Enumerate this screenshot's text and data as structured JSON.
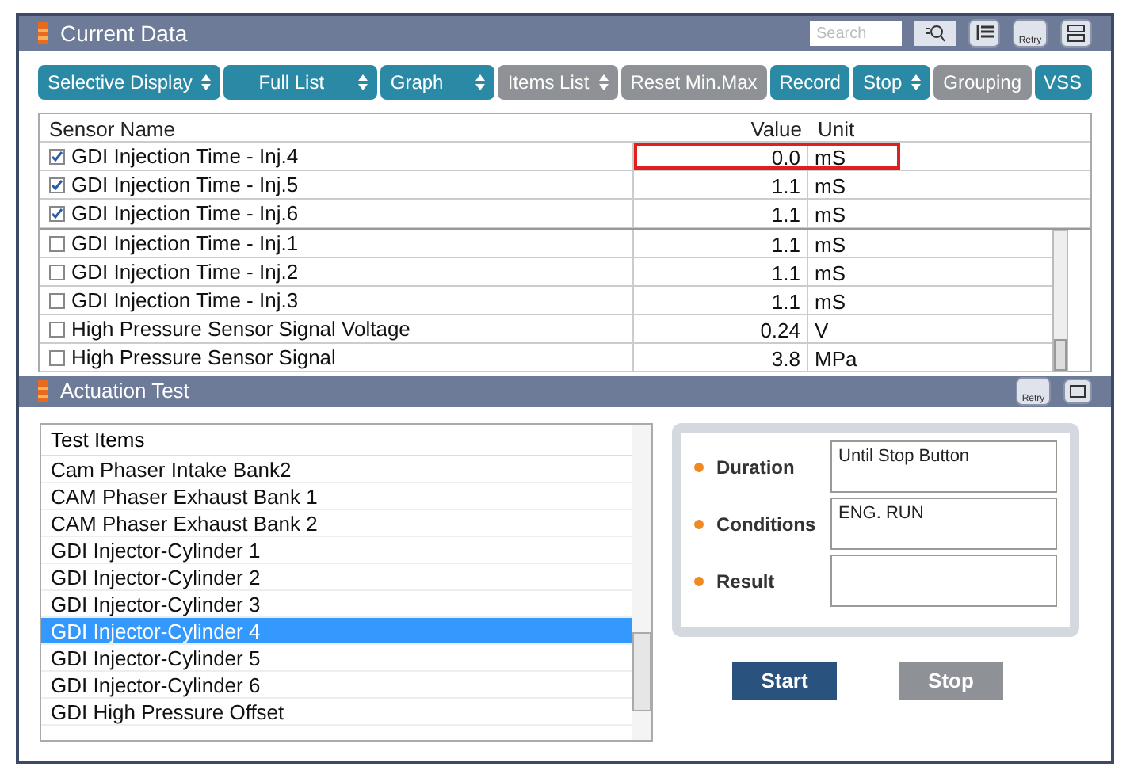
{
  "current_data": {
    "title": "Current Data",
    "search": {
      "placeholder": "Search"
    },
    "retry_label": "Retry",
    "toolbar": [
      {
        "label": "Selective Display",
        "dropdown": true,
        "disabled": false
      },
      {
        "label": "Full List",
        "dropdown": true,
        "disabled": false
      },
      {
        "label": "Graph",
        "dropdown": true,
        "disabled": false
      },
      {
        "label": "Items List",
        "dropdown": true,
        "disabled": true
      },
      {
        "label": "Reset Min.Max",
        "dropdown": false,
        "disabled": true
      },
      {
        "label": "Record",
        "dropdown": false,
        "disabled": false
      },
      {
        "label": "Stop",
        "dropdown": true,
        "disabled": false
      },
      {
        "label": "Grouping",
        "dropdown": false,
        "disabled": true
      },
      {
        "label": "VSS",
        "dropdown": false,
        "disabled": false
      }
    ],
    "table": {
      "columns": [
        "Sensor Name",
        "Value",
        "Unit"
      ],
      "pinned_rows": [
        {
          "checked": true,
          "name": "GDI Injection Time - Inj.4",
          "value": "0.0",
          "unit": "mS",
          "highlighted": true
        },
        {
          "checked": true,
          "name": "GDI Injection Time - Inj.5",
          "value": "1.1",
          "unit": "mS",
          "highlighted": false
        },
        {
          "checked": true,
          "name": "GDI Injection Time - Inj.6",
          "value": "1.1",
          "unit": "mS",
          "highlighted": false
        }
      ],
      "rows": [
        {
          "checked": false,
          "name": "GDI Injection Time - Inj.1",
          "value": "1.1",
          "unit": "mS",
          "highlighted": false
        },
        {
          "checked": false,
          "name": "GDI Injection Time - Inj.2",
          "value": "1.1",
          "unit": "mS",
          "highlighted": false
        },
        {
          "checked": false,
          "name": "GDI Injection Time - Inj.3",
          "value": "1.1",
          "unit": "mS",
          "highlighted": false
        },
        {
          "checked": false,
          "name": "High Pressure Sensor Signal Voltage",
          "value": "0.24",
          "unit": "V",
          "highlighted": false
        },
        {
          "checked": false,
          "name": "High Pressure Sensor Signal",
          "value": "3.8",
          "unit": "MPa",
          "highlighted": false
        }
      ]
    }
  },
  "actuation_test": {
    "title": "Actuation Test",
    "retry_label": "Retry",
    "list_header": "Test Items",
    "items": [
      {
        "label": "Cam Phaser Intake Bank2",
        "selected": false
      },
      {
        "label": "CAM Phaser Exhaust Bank 1",
        "selected": false
      },
      {
        "label": "CAM Phaser Exhaust Bank 2",
        "selected": false
      },
      {
        "label": "GDI Injector-Cylinder 1",
        "selected": false
      },
      {
        "label": "GDI Injector-Cylinder 2",
        "selected": false
      },
      {
        "label": "GDI Injector-Cylinder 3",
        "selected": false
      },
      {
        "label": "GDI Injector-Cylinder 4",
        "selected": true
      },
      {
        "label": "GDI Injector-Cylinder 5",
        "selected": false
      },
      {
        "label": "GDI Injector-Cylinder 6",
        "selected": false
      },
      {
        "label": "GDI High Pressure Offset",
        "selected": false
      }
    ],
    "fields": [
      {
        "label": "Duration",
        "value": "Until Stop Button"
      },
      {
        "label": "Conditions",
        "value": "ENG. RUN"
      },
      {
        "label": "Result"
      }
    ],
    "buttons": [
      {
        "label": "Start",
        "disabled": false
      },
      {
        "label": "Stop",
        "disabled": true
      }
    ]
  }
}
